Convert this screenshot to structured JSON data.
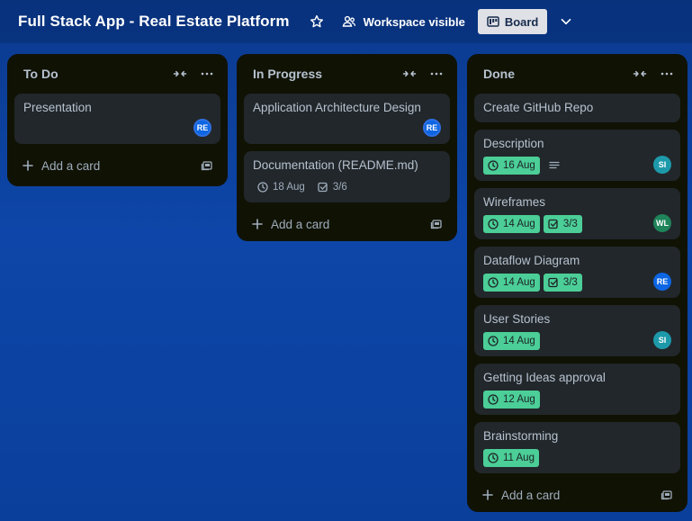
{
  "header": {
    "title": "Full Stack App - Real Estate Platform",
    "visibility_label": "Workspace visible",
    "view_label": "Board"
  },
  "lists": {
    "todo": {
      "title": "To Do",
      "add_card_label": "Add a card",
      "cards": [
        {
          "title": "Presentation",
          "member": "RE"
        }
      ]
    },
    "inprogress": {
      "title": "In Progress",
      "add_card_label": "Add a card",
      "cards": [
        {
          "title": "Application Architecture Design",
          "member": "RE"
        },
        {
          "title": "Documentation (README.md)",
          "due": "18 Aug",
          "checklist": "3/6"
        }
      ]
    },
    "done": {
      "title": "Done",
      "add_card_label": "Add a card",
      "cards": [
        {
          "title": "Create GitHub Repo"
        },
        {
          "title": "Description",
          "due": "16 Aug",
          "member": "SI"
        },
        {
          "title": "Wireframes",
          "due": "14 Aug",
          "checklist": "3/3",
          "member": "WL"
        },
        {
          "title": "Dataflow Diagram",
          "due": "14 Aug",
          "checklist": "3/3",
          "member": "RE"
        },
        {
          "title": "User Stories",
          "due": "14 Aug",
          "member": "SI"
        },
        {
          "title": "Getting Ideas approval",
          "due": "12 Aug"
        },
        {
          "title": "Brainstorming",
          "due": "11 Aug"
        }
      ]
    }
  },
  "colors": {
    "avatar_RE": "#0c66e4",
    "avatar_SI": "#1d9aaa",
    "avatar_WL": "#1f845a",
    "due_complete": "#4bce97",
    "list_bg": "#101204",
    "card_bg": "#22272b"
  },
  "icons": {
    "star": "star-icon",
    "visibility": "people-icon",
    "board": "board-icon",
    "dropdown": "chevron-down-icon",
    "collapse": "collapse-icon",
    "more": "more-icon",
    "add": "plus-icon",
    "template": "template-icon",
    "due": "clock-icon",
    "checklist": "checkbox-icon",
    "description": "description-icon"
  }
}
